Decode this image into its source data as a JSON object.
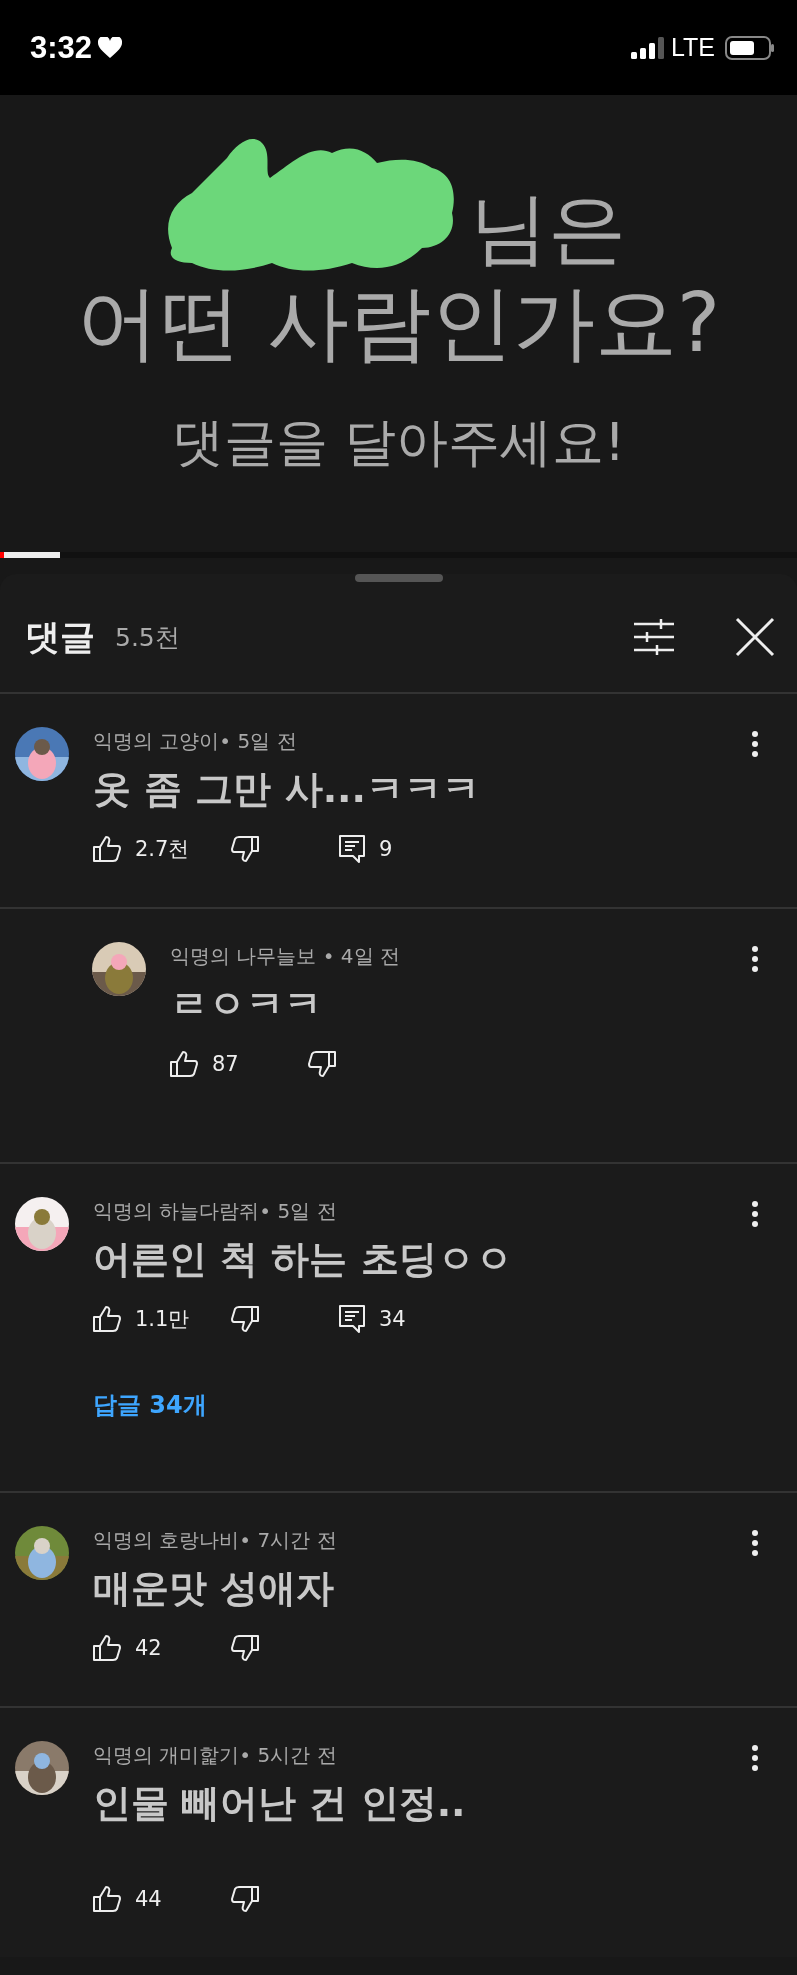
{
  "status_bar": {
    "time": "3:32",
    "network": "LTE"
  },
  "video": {
    "title_line_1": "님은",
    "title_line_2": "어떤 사람인가요?",
    "subtitle": "댓글을 달아주세요!",
    "level": 0.005
  },
  "comments_panel": {
    "title": "댓글",
    "count": "5.5천"
  },
  "comments": [
    {
      "kind": "comment",
      "meta": "익명의 고양이• 5일 전",
      "text": "옷 좀 그만 사...ㅋㅋㅋ",
      "likes": "2.7천",
      "replies": "9"
    },
    {
      "kind": "reply",
      "meta": "익명의 나무늘보 • 4일 전",
      "text": "ㄹㅇㅋㅋ",
      "likes": "87"
    },
    {
      "kind": "comment",
      "meta": "익명의 하늘다람쥐• 5일 전",
      "text": "어른인 척 하는 초딩ㅇㅇ",
      "likes": "1.1만",
      "replies": "34",
      "view_replies": "답글 34개"
    },
    {
      "kind": "comment",
      "meta": "익명의 호랑나비• 7시간 전",
      "text": "매운맛 성애자",
      "likes": "42"
    },
    {
      "kind": "comment",
      "meta": "익명의 개미핥기• 5시간 전",
      "text": "인물 빼어난 건 인정..",
      "likes": "44"
    }
  ]
}
